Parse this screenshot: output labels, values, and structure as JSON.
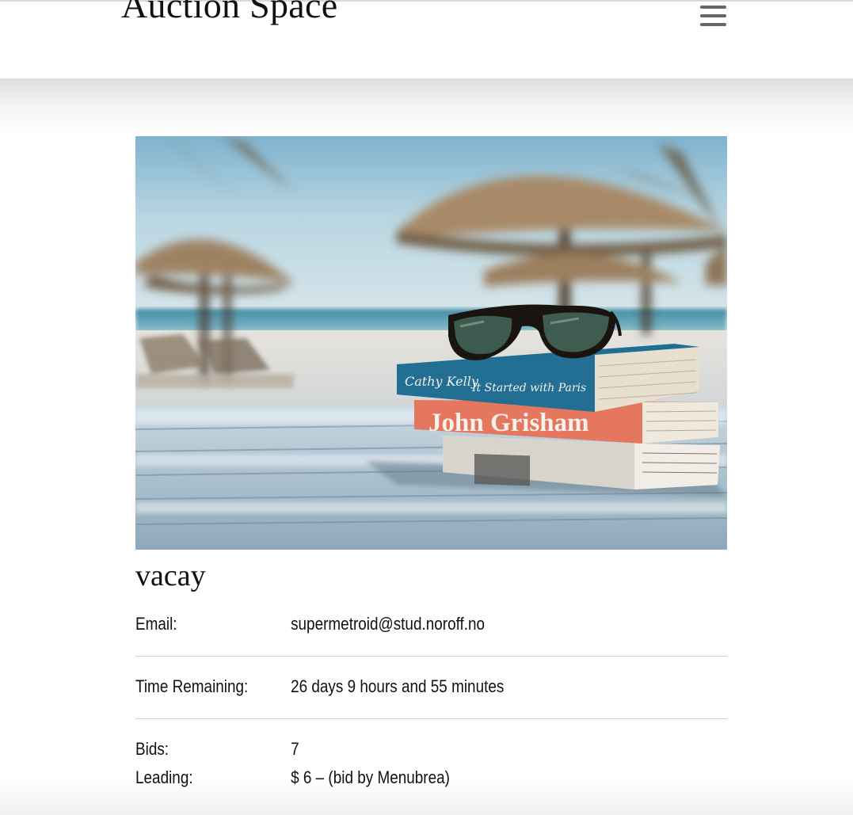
{
  "header": {
    "brand": "Auction Space",
    "menu_icon": "hamburger-menu-icon"
  },
  "listing": {
    "image_alt": "vacay",
    "title": "vacay",
    "rows": [
      {
        "label": "Email:",
        "value": "supermetroid@stud.noroff.no"
      },
      {
        "label": "Time Remaining:",
        "value": "26 days 9 hours and 55 minutes"
      },
      {
        "label": "Bids:",
        "value": "7"
      },
      {
        "label": "Leading:",
        "value": "$ 6 – (bid by Menubrea)"
      }
    ]
  },
  "photo_text": {
    "book1": "Cathy Kelly",
    "book1_subtitle": "It Started with Paris",
    "book2": "John Grisham"
  },
  "colors": {
    "header_bg": "#ffffff",
    "menu_icon": "#666666",
    "divider": "#cfcfcf",
    "text": "#111111"
  }
}
